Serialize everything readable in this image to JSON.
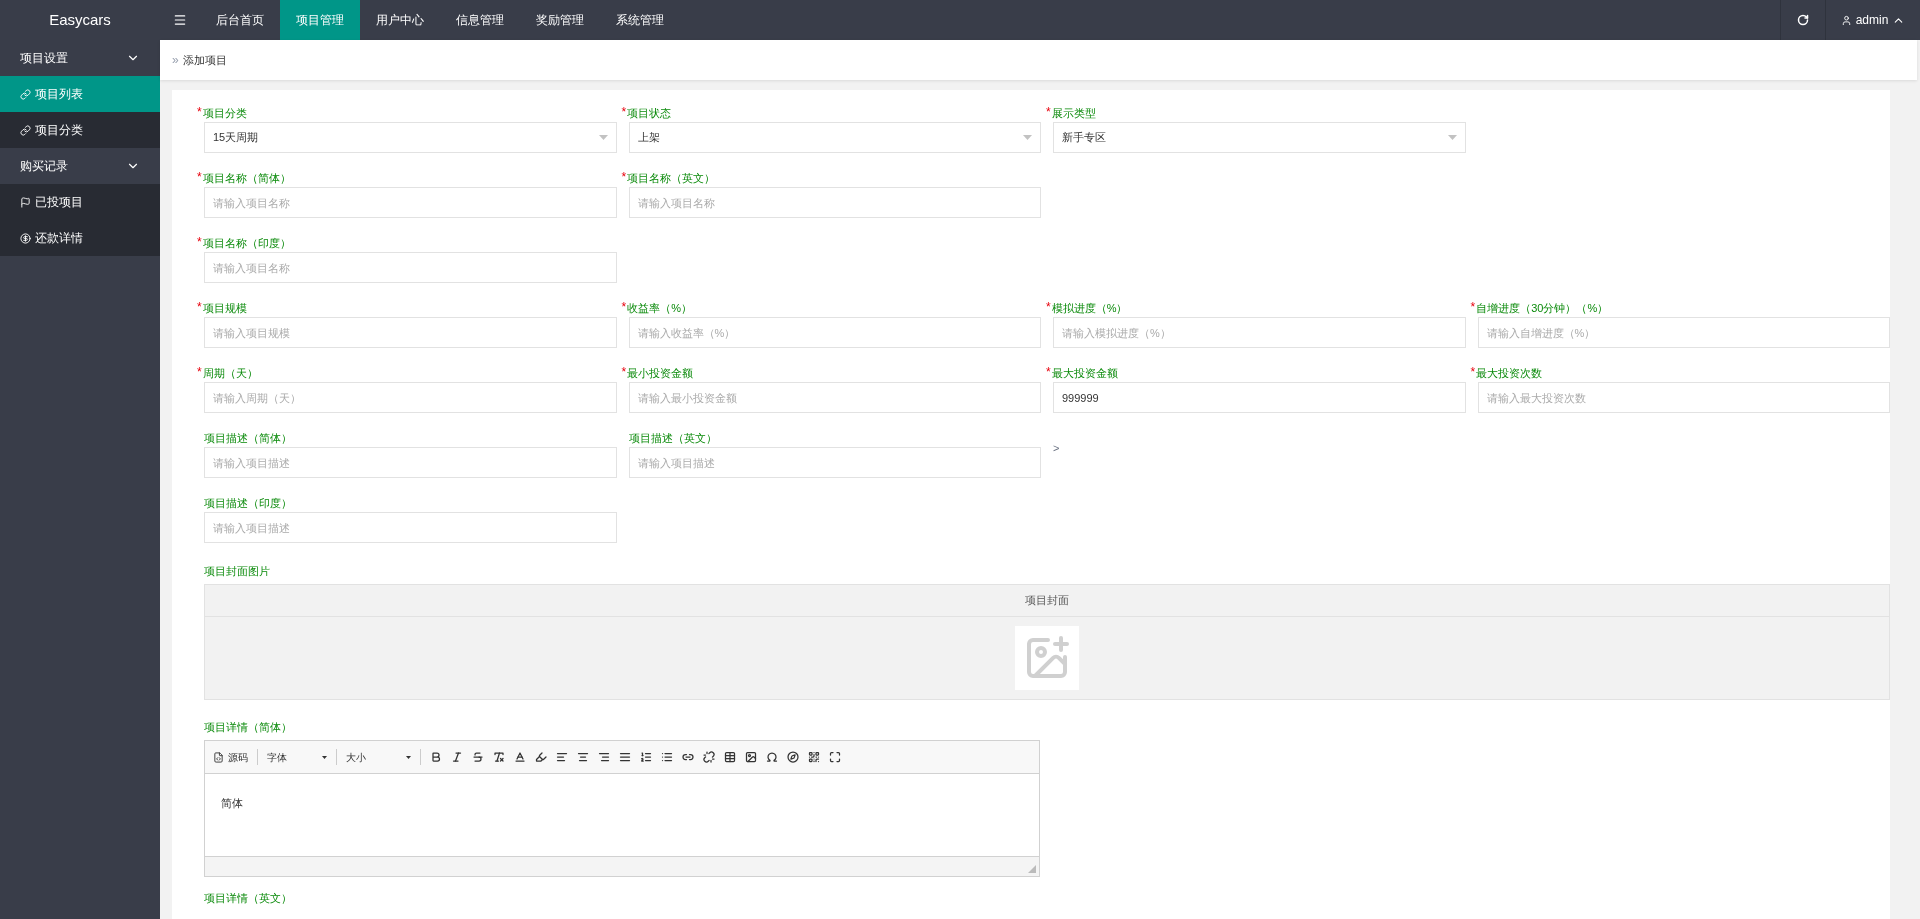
{
  "topbar": {
    "brand": "Easycars",
    "nav": [
      {
        "label": "后台首页",
        "selected": false
      },
      {
        "label": "项目管理",
        "selected": true
      },
      {
        "label": "用户中心",
        "selected": false
      },
      {
        "label": "信息管理",
        "selected": false
      },
      {
        "label": "奖励管理",
        "selected": false
      },
      {
        "label": "系统管理",
        "selected": false
      }
    ],
    "user": "admin"
  },
  "sidebar": {
    "groups": [
      {
        "label": "项目设置",
        "expanded": true,
        "children": [
          {
            "label": "项目列表",
            "selected": true,
            "kind": "link"
          },
          {
            "label": "项目分类",
            "selected": false,
            "kind": "link"
          }
        ]
      },
      {
        "label": "购买记录",
        "expanded": true,
        "children": [
          {
            "label": "已投项目",
            "selected": false,
            "kind": "flag"
          },
          {
            "label": "还款详情",
            "selected": false,
            "kind": "dollar"
          }
        ]
      }
    ]
  },
  "breadcrumb_separator": "»",
  "breadcrumb": "添加项目",
  "form": {
    "required_mark": "*",
    "rows": [
      [
        {
          "kind": "select",
          "label": "项目分类",
          "required": true,
          "value": "15天周期"
        },
        {
          "kind": "select",
          "label": "项目状态",
          "required": true,
          "value": "上架"
        },
        {
          "kind": "select",
          "label": "展示类型",
          "required": true,
          "value": "新手专区"
        }
      ],
      [
        {
          "kind": "input",
          "label": "项目名称（简体）",
          "required": true,
          "placeholder": "请输入项目名称"
        },
        {
          "kind": "input",
          "label": "项目名称（英文）",
          "required": true,
          "placeholder": "请输入项目名称"
        }
      ],
      [
        {
          "kind": "input",
          "label": "项目名称（印度）",
          "required": true,
          "placeholder": "请输入项目名称"
        }
      ],
      [
        {
          "kind": "input",
          "label": "项目规模",
          "required": true,
          "placeholder": "请输入项目规模"
        },
        {
          "kind": "input",
          "label": "收益率（%）",
          "required": true,
          "placeholder": "请输入收益率（%）"
        },
        {
          "kind": "input",
          "label": "模拟进度（%）",
          "required": true,
          "placeholder": "请输入模拟进度（%）"
        },
        {
          "kind": "input",
          "label": "自增进度（30分钟）（%）",
          "required": true,
          "placeholder": "请输入自增进度（%）"
        }
      ],
      [
        {
          "kind": "input",
          "label": "周期（天）",
          "required": true,
          "placeholder": "请输入周期（天）"
        },
        {
          "kind": "input",
          "label": "最小投资金额",
          "required": true,
          "placeholder": "请输入最小投资金额"
        },
        {
          "kind": "input",
          "label": "最大投资金额",
          "required": true,
          "value": "999999"
        },
        {
          "kind": "input",
          "label": "最大投资次数",
          "required": true,
          "placeholder": "请输入最大投资次数"
        }
      ],
      [
        {
          "kind": "input",
          "label": "项目描述（简体）",
          "required": false,
          "placeholder": "请输入项目描述"
        },
        {
          "kind": "input",
          "label": "项目描述（英文）",
          "required": false,
          "placeholder": "请输入项目描述"
        },
        {
          "kind": "mark",
          "text": ">"
        }
      ],
      [
        {
          "kind": "input",
          "label": "项目描述（印度）",
          "required": false,
          "placeholder": "请输入项目描述"
        }
      ]
    ],
    "cover": {
      "label": "项目封面图片",
      "header": "项目封面"
    },
    "editor": {
      "label": "项目详情（简体）",
      "source": "源码",
      "font": "字体",
      "size": "大小",
      "body": "简体"
    },
    "next_label": "项目详情（英文）"
  }
}
